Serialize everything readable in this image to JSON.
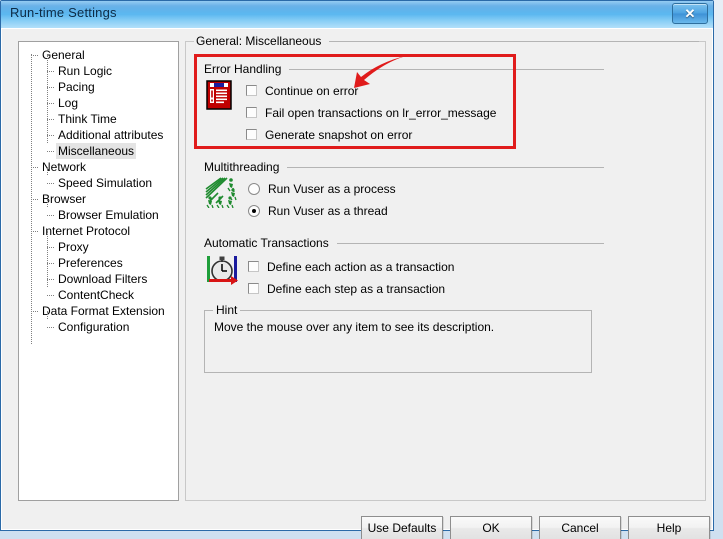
{
  "window": {
    "title": "Run-time Settings",
    "close_label": "✕"
  },
  "tree": {
    "items": [
      {
        "label": "General",
        "level": 0,
        "selected": false
      },
      {
        "label": "Run Logic",
        "level": 1,
        "selected": false
      },
      {
        "label": "Pacing",
        "level": 1,
        "selected": false
      },
      {
        "label": "Log",
        "level": 1,
        "selected": false
      },
      {
        "label": "Think Time",
        "level": 1,
        "selected": false
      },
      {
        "label": "Additional attributes",
        "level": 1,
        "selected": false
      },
      {
        "label": "Miscellaneous",
        "level": 1,
        "selected": true
      },
      {
        "label": "Network",
        "level": 0,
        "selected": false
      },
      {
        "label": "Speed Simulation",
        "level": 1,
        "selected": false
      },
      {
        "label": "Browser",
        "level": 0,
        "selected": false
      },
      {
        "label": "Browser Emulation",
        "level": 1,
        "selected": false
      },
      {
        "label": "Internet Protocol",
        "level": 0,
        "selected": false
      },
      {
        "label": "Proxy",
        "level": 1,
        "selected": false
      },
      {
        "label": "Preferences",
        "level": 1,
        "selected": false
      },
      {
        "label": "Download Filters",
        "level": 1,
        "selected": false
      },
      {
        "label": "ContentCheck",
        "level": 1,
        "selected": false
      },
      {
        "label": "Data Format Extension",
        "level": 0,
        "selected": false
      },
      {
        "label": "Configuration",
        "level": 1,
        "selected": false
      }
    ]
  },
  "content": {
    "group_title": "General: Miscellaneous",
    "error_handling": {
      "title": "Error Handling",
      "icon": "error-document-icon",
      "highlighted": true,
      "highlight_color": "#e01b1b",
      "options": [
        {
          "label": "Continue on error",
          "checked": false
        },
        {
          "label": "Fail open transactions on lr_error_message",
          "checked": false
        },
        {
          "label": "Generate snapshot on error",
          "checked": false
        }
      ]
    },
    "multithreading": {
      "title": "Multithreading",
      "icon": "running-threads-icon",
      "options": [
        {
          "label": "Run Vuser as a process",
          "selected": false
        },
        {
          "label": "Run Vuser as a thread",
          "selected": true
        }
      ]
    },
    "automatic_transactions": {
      "title": "Automatic Transactions",
      "icon": "stopwatch-icon",
      "options": [
        {
          "label": "Define each action as a transaction",
          "checked": false
        },
        {
          "label": "Define each step as a transaction",
          "checked": false
        }
      ]
    },
    "hint": {
      "title": "Hint",
      "text": "Move the mouse over any item to see its description."
    }
  },
  "footer": {
    "buttons": [
      {
        "label": "Use Defaults"
      },
      {
        "label": "OK"
      },
      {
        "label": "Cancel"
      },
      {
        "label": "Help"
      }
    ]
  },
  "annotation": {
    "arrow": {
      "name": "red-pointer-arrow",
      "color": "#e01b1b",
      "points_to": "Continue on error"
    }
  }
}
